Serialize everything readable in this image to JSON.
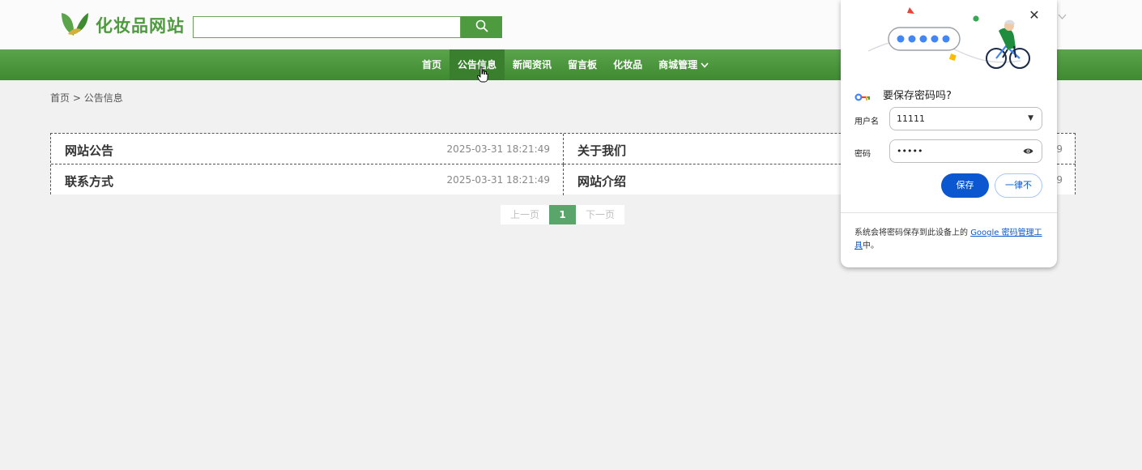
{
  "header": {
    "site_name": "化妆品网站",
    "search": {
      "value": "",
      "placeholder": ""
    },
    "brand_color": "#4e9a3e"
  },
  "nav": {
    "items": [
      {
        "label": "首页"
      },
      {
        "label": "公告信息",
        "active": true
      },
      {
        "label": "新闻资讯"
      },
      {
        "label": "留言板"
      },
      {
        "label": "化妆品"
      },
      {
        "label": "商城管理"
      }
    ]
  },
  "breadcrumb": {
    "home": "首页",
    "separator": ">",
    "current": "公告信息"
  },
  "notices": [
    {
      "title": "网站公告",
      "date": "2025-03-31 18:21:49"
    },
    {
      "title": "关于我们",
      "date": "9"
    },
    {
      "title": "联系方式",
      "date": "2025-03-31 18:21:49"
    },
    {
      "title": "网站介绍",
      "date": "9"
    }
  ],
  "pagination": {
    "prev": "上一页",
    "current": "1",
    "next": "下一页"
  },
  "password_dialog": {
    "title": "要保存密码吗?",
    "username_label": "用户名",
    "username_value": "11111",
    "password_label": "密码",
    "password_value": "•••••",
    "save_label": "保存",
    "never_label": "一律不",
    "footer_text": "系统会将密码保存到此设备上的",
    "footer_link": "Google 密码管理工具",
    "footer_suffix": "中。",
    "accent_color": "#0b57d0"
  }
}
